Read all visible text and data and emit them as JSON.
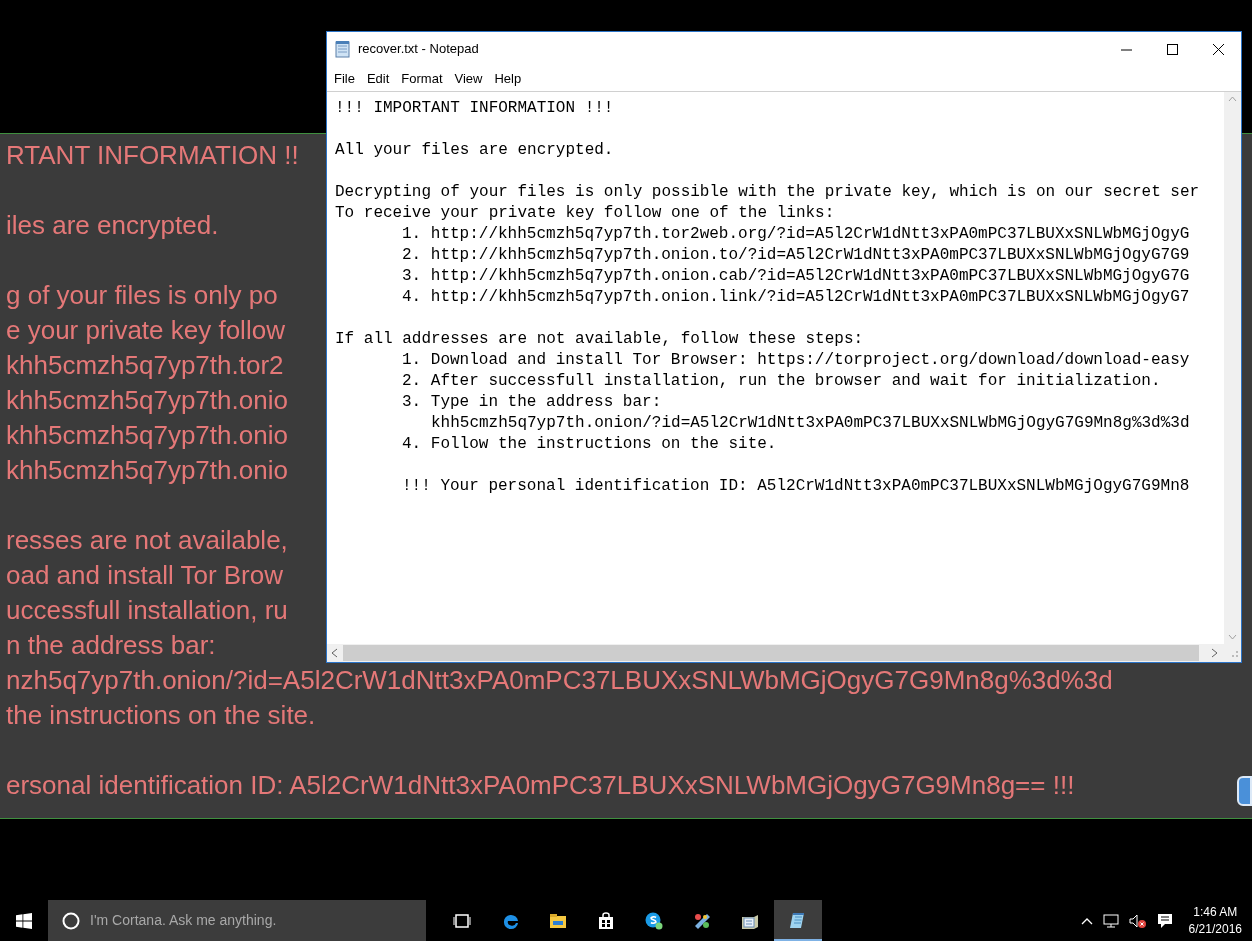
{
  "background_note": {
    "paragraphs": [
      [
        "RTANT INFORMATION !!"
      ],
      [
        "iles are encrypted."
      ],
      [
        "g of your files is only po",
        "e your private key follow",
        "khh5cmzh5q7yp7th.tor2",
        "khh5cmzh5q7yp7th.onio",
        "khh5cmzh5q7yp7th.onio",
        "khh5cmzh5q7yp7th.onio"
      ],
      [
        "resses are not available,",
        "oad and install Tor Brow",
        "uccessfull installation, ru",
        "n the address bar:",
        "nzh5q7yp7th.onion/?id=A5l2CrW1dNtt3xPA0mPC37LBUXxSNLWbMGjOgyG7G9Mn8g%3d%3d",
        "the instructions on the site."
      ],
      [
        "ersonal identification ID: A5l2CrW1dNtt3xPA0mPC37LBUXxSNLWbMGjOgyG7G9Mn8g== !!!"
      ]
    ]
  },
  "notepad": {
    "title": "recover.txt - Notepad",
    "menu": [
      "File",
      "Edit",
      "Format",
      "View",
      "Help"
    ],
    "paragraphs": [
      [
        {
          "kind": "plain",
          "text": "!!! IMPORTANT INFORMATION !!!"
        }
      ],
      [
        {
          "kind": "plain",
          "text": "All your files are encrypted."
        }
      ],
      [
        {
          "kind": "plain",
          "text": "Decrypting of your files is only possible with the private key, which is on our secret ser"
        },
        {
          "kind": "plain",
          "text": "To receive your private key follow one of the links:"
        },
        {
          "kind": "item",
          "text": "1. http://khh5cmzh5q7yp7th.tor2web.org/?id=A5l2CrW1dNtt3xPA0mPC37LBUXxSNLWbMGjOgyG"
        },
        {
          "kind": "item",
          "text": "2. http://khh5cmzh5q7yp7th.onion.to/?id=A5l2CrW1dNtt3xPA0mPC37LBUXxSNLWbMGjOgyG7G9"
        },
        {
          "kind": "item",
          "text": "3. http://khh5cmzh5q7yp7th.onion.cab/?id=A5l2CrW1dNtt3xPA0mPC37LBUXxSNLWbMGjOgyG7G"
        },
        {
          "kind": "item",
          "text": "4. http://khh5cmzh5q7yp7th.onion.link/?id=A5l2CrW1dNtt3xPA0mPC37LBUXxSNLWbMGjOgyG7"
        }
      ],
      [
        {
          "kind": "plain",
          "text": "If all addresses are not available, follow these steps:"
        },
        {
          "kind": "item",
          "text": "1. Download and install Tor Browser: https://torproject.org/download/download-easy"
        },
        {
          "kind": "item",
          "text": "2. After successfull installation, run the browser and wait for initialization."
        },
        {
          "kind": "item",
          "text": "3. Type in the address bar:"
        },
        {
          "kind": "continuation",
          "text": "khh5cmzh5q7yp7th.onion/?id=A5l2CrW1dNtt3xPA0mPC37LBUXxSNLWbMGjOgyG7G9Mn8g%3d%3d"
        },
        {
          "kind": "item",
          "text": "4. Follow the instructions on the site."
        }
      ],
      [
        {
          "kind": "item",
          "text": "!!! Your personal identification ID: A5l2CrW1dNtt3xPA0mPC37LBUXxSNLWbMGjOgyG7G9Mn8"
        }
      ]
    ]
  },
  "taskbar": {
    "search": {
      "placeholder": "I'm Cortana. Ask me anything."
    },
    "apps": [
      {
        "kind": "task-view",
        "active": false
      },
      {
        "kind": "edge",
        "active": false
      },
      {
        "kind": "explorer",
        "active": false
      },
      {
        "kind": "store",
        "active": false
      },
      {
        "kind": "skype",
        "active": false
      },
      {
        "kind": "paint",
        "active": false
      },
      {
        "kind": "folder-pad",
        "active": false
      },
      {
        "kind": "notepad",
        "active": true
      }
    ],
    "clock": {
      "time": "1:46 AM",
      "date": "6/21/2016"
    }
  }
}
